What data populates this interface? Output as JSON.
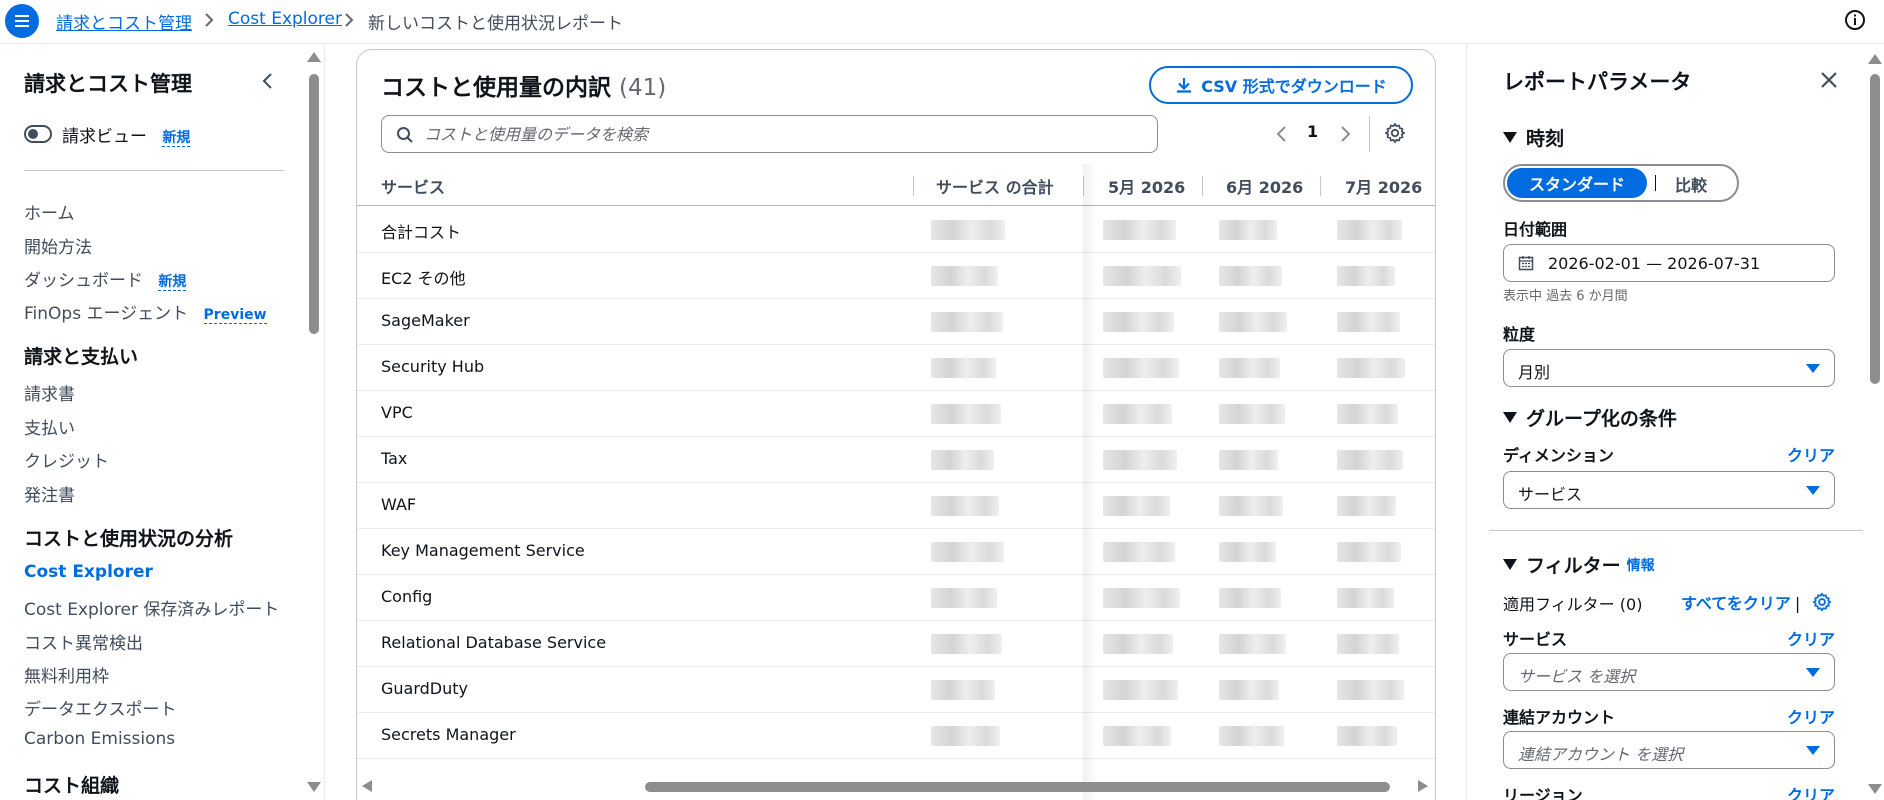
{
  "breadcrumb": {
    "items": [
      "請求とコスト管理",
      "Cost Explorer"
    ],
    "current": "新しいコストと使用状況レポート"
  },
  "nav": {
    "title": "請求とコスト管理",
    "billing_view_label": "請求ビュー",
    "new_badge": "新規",
    "preview_badge": "Preview",
    "top_items": [
      "ホーム",
      "開始方法",
      "ダッシュボード",
      "FinOps エージェント"
    ],
    "sections": [
      {
        "title": "請求と支払い",
        "items": [
          "請求書",
          "支払い",
          "クレジット",
          "発注書"
        ]
      },
      {
        "title": "コストと使用状況の分析",
        "items": [
          "Cost Explorer",
          "Cost Explorer 保存済みレポート",
          "コスト異常検出",
          "無料利用枠",
          "データエクスポート",
          "Carbon Emissions"
        ]
      },
      {
        "title": "コスト組織",
        "items": []
      }
    ],
    "active_item": "Cost Explorer"
  },
  "main": {
    "title": "コストと使用量の内訳",
    "count": "(41)",
    "csv_button": "CSV 形式でダウンロード",
    "search_placeholder": "コストと使用量のデータを検索",
    "page": "1",
    "columns": [
      "サービス",
      "サービス の合計",
      "5月 2026",
      "6月 2026",
      "7月 2026"
    ],
    "rows": [
      "合計コスト",
      "EC2 その他",
      "SageMaker",
      "Security Hub",
      "VPC",
      "Tax",
      "WAF",
      "Key Management Service",
      "Config",
      "Relational Database Service",
      "GuardDuty",
      "Secrets Manager"
    ]
  },
  "params": {
    "title": "レポートパラメータ",
    "time_section": "時刻",
    "seg_standard": "スタンダード",
    "seg_compare": "比較",
    "date_range_label": "日付範囲",
    "date_range_value": "2026-02-01 — 2026-07-31",
    "date_hint": "表示中 過去 6 か月間",
    "granularity_label": "粒度",
    "granularity_value": "月別",
    "group_section": "グループ化の条件",
    "dimension_label": "ディメンション",
    "clear": "クリア",
    "dimension_value": "サービス",
    "filter_section": "フィルター",
    "info": "情報",
    "applied_filters": "適用フィルター (0)",
    "clear_all": "すべてをクリア",
    "service_label": "サービス",
    "service_placeholder": "サービス を選択",
    "linked_account_label": "連結アカウント",
    "linked_account_placeholder": "連結アカウント を選択",
    "region_label": "リージョン"
  },
  "colors": {
    "accent": "#006ce0",
    "text": "#0f141a",
    "muted": "#414d5c"
  }
}
